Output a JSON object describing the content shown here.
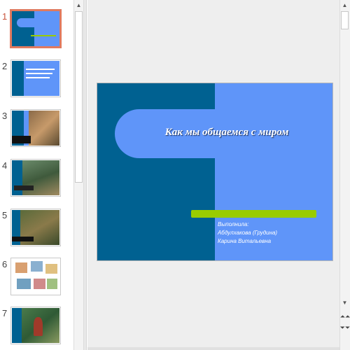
{
  "thumbnails": [
    {
      "number": "1",
      "active": true
    },
    {
      "number": "2",
      "active": false
    },
    {
      "number": "3",
      "active": false
    },
    {
      "number": "4",
      "active": false
    },
    {
      "number": "5",
      "active": false
    },
    {
      "number": "6",
      "active": false
    },
    {
      "number": "7",
      "active": false
    }
  ],
  "slide": {
    "title": "Как мы общаемся с миром",
    "author_line1": "Выполнила:",
    "author_line2": "Абдулхакова (Грудина)",
    "author_line3": "Карина Витальевна",
    "colors": {
      "dark": "#006191",
      "light": "#5f95f9",
      "accent": "#99cc00"
    }
  },
  "scrollbar": {
    "up_icon": "▲",
    "down_icon": "▼",
    "prev_slide_icon": "⏶⏶",
    "next_slide_icon": "⏷⏷"
  }
}
